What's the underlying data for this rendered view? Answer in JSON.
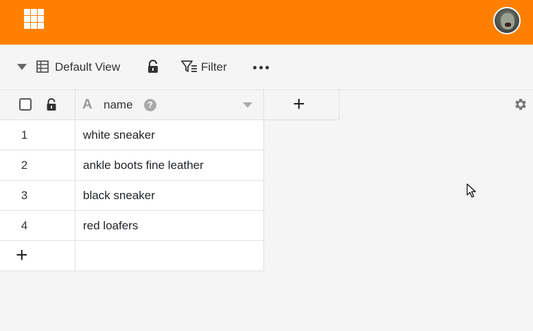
{
  "toolbar": {
    "view_label": "Default View",
    "filter_label": "Filter"
  },
  "table": {
    "columns": [
      {
        "name": "name",
        "type_icon": "A"
      }
    ],
    "rows": [
      {
        "index": "1",
        "name": "white sneaker"
      },
      {
        "index": "2",
        "name": "ankle boots fine leather"
      },
      {
        "index": "3",
        "name": "black sneaker"
      },
      {
        "index": "4",
        "name": "red loafers"
      }
    ],
    "help_glyph": "?",
    "add_glyph": "+"
  },
  "colors": {
    "brand": "#ff8000",
    "background": "#f5f5f5"
  },
  "icons": [
    "apps-grid-icon",
    "avatar",
    "collapse-caret-icon",
    "table-view-icon",
    "lock-icon",
    "filter-icon",
    "more-icon",
    "checkbox",
    "text-type-icon",
    "help-icon",
    "column-menu-caret-icon",
    "add-column-icon",
    "settings-gear-icon",
    "add-row-icon",
    "mouse-cursor"
  ]
}
